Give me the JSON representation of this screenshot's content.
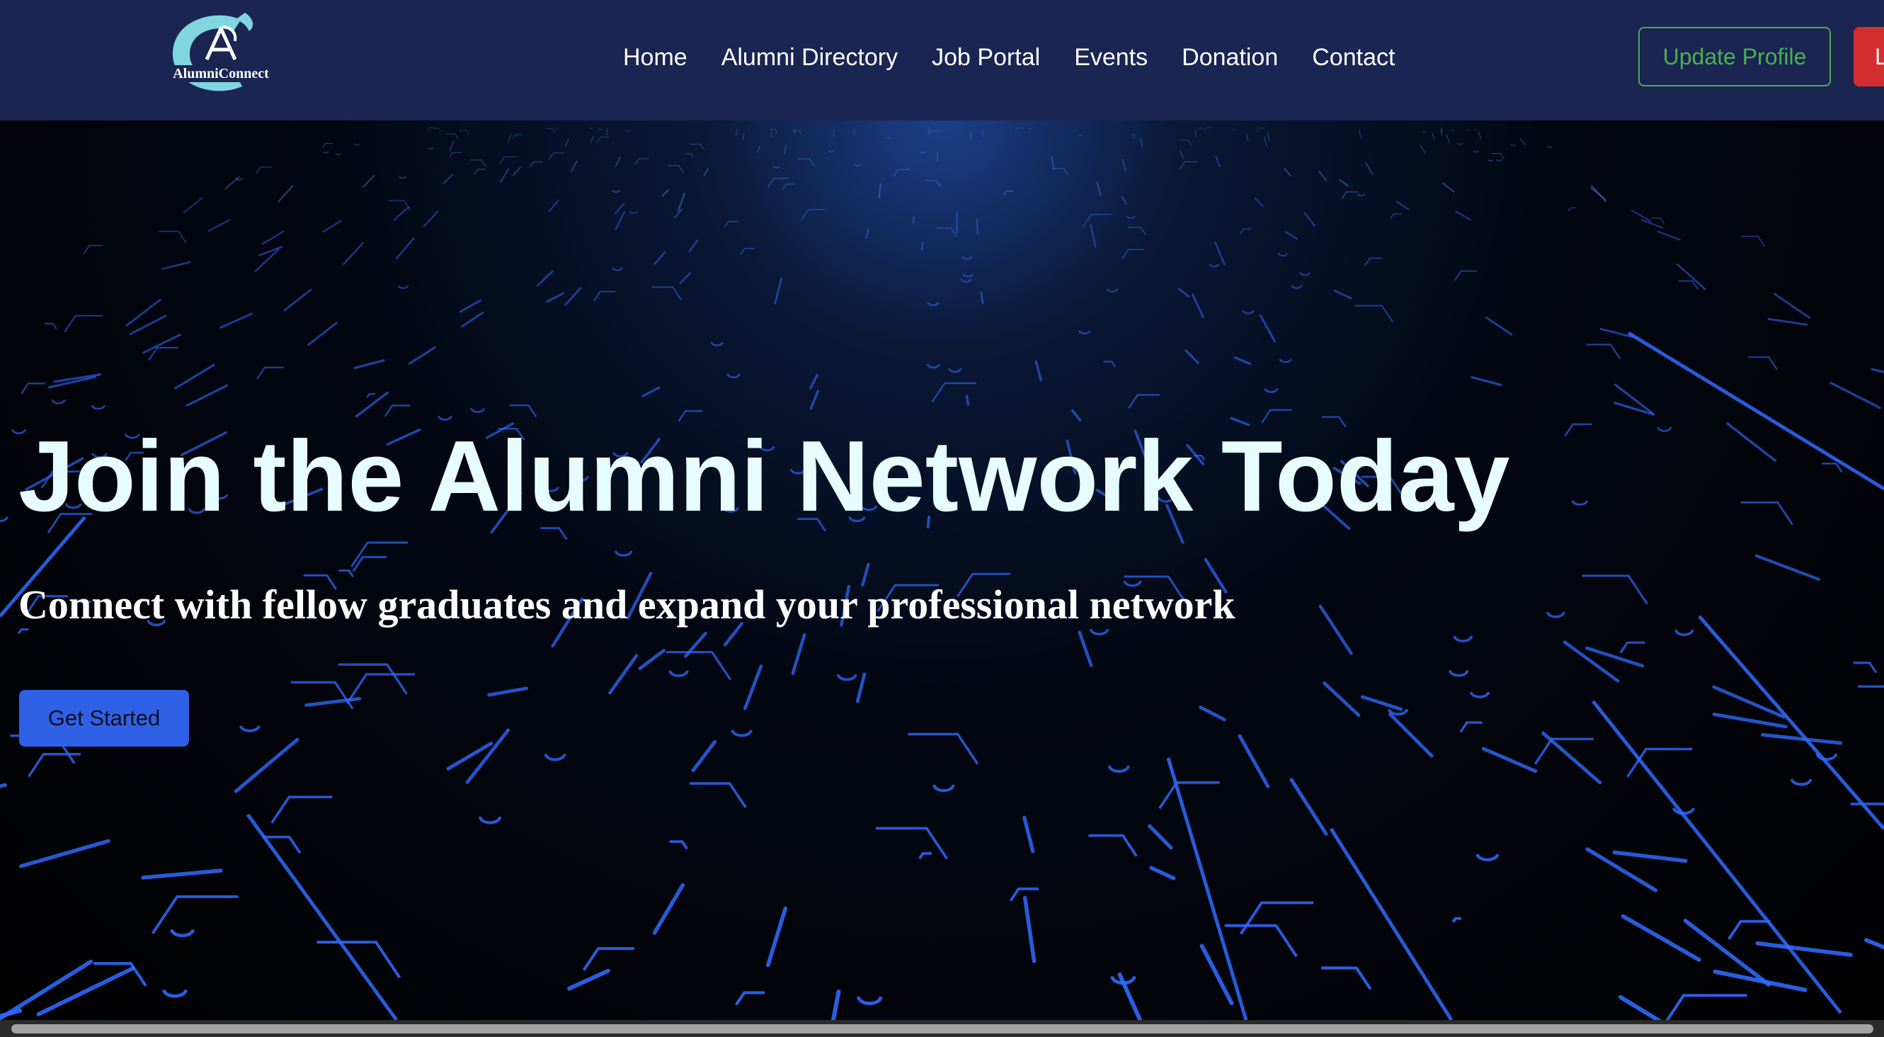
{
  "brand": {
    "name": "AlumniConnect",
    "logo_icon": "alumni-connect-logo",
    "accent_color": "#7fd6e0"
  },
  "nav": {
    "links": [
      {
        "label": "Home"
      },
      {
        "label": "Alumni Directory"
      },
      {
        "label": "Job Portal"
      },
      {
        "label": "Events"
      },
      {
        "label": "Donation"
      },
      {
        "label": "Contact"
      }
    ],
    "update_profile_label": "Update Profile",
    "logout_label": "L",
    "background_color": "#1b2552",
    "update_profile_color": "#4caf50",
    "logout_color": "#d32f2f"
  },
  "hero": {
    "title": "Join the Alumni Network Today",
    "subtitle": "Connect with fellow graduates and expand your professional network",
    "cta_label": "Get Started",
    "cta_color": "#3060e6",
    "background_icon": "circuit-board-pattern"
  }
}
